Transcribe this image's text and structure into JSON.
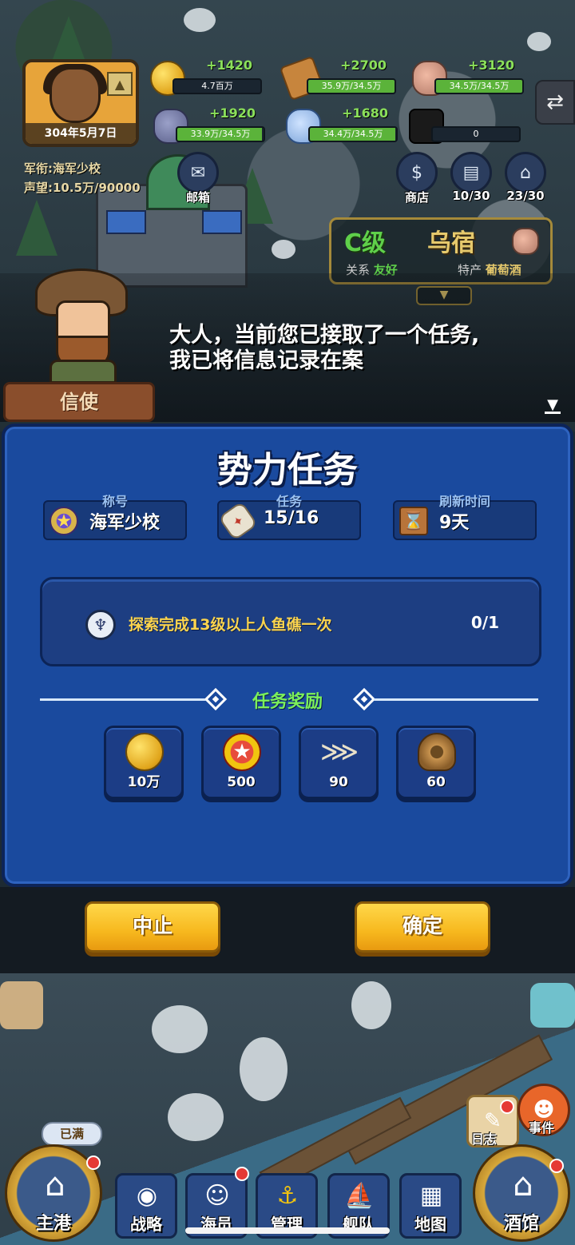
{
  "player": {
    "date": "304年5月7日",
    "rank_line": "军衔:海军少校",
    "fame_line": "声望:10.5万/90000"
  },
  "resources": [
    {
      "icon": "gold-coin-icon",
      "gain": "+1420",
      "amount": "4.7百万",
      "fill": 1.0
    },
    {
      "icon": "wood-icon",
      "gain": "+2700",
      "amount": "35.9万/34.5万",
      "fill": 1.0
    },
    {
      "icon": "stone-icon",
      "gain": "+3120",
      "amount": "34.5万/34.5万",
      "fill": 1.0
    },
    {
      "icon": "iron-ore-icon",
      "gain": "+1920",
      "amount": "33.9万/34.5万",
      "fill": 0.98
    },
    {
      "icon": "crystal-icon",
      "gain": "+1680",
      "amount": "34.4万/34.5万",
      "fill": 0.99
    },
    {
      "icon": "scholar-cap-icon",
      "gain": "",
      "amount": "0",
      "fill": 0.0
    }
  ],
  "top_buttons": {
    "mail": "邮箱",
    "shop": "商店",
    "books": "10/30",
    "crew": "23/30"
  },
  "city_card": {
    "grade": "C级",
    "name": "乌宿",
    "relation_label": "关系",
    "relation_value": "友好",
    "specialty_label": "特产",
    "specialty_value": "葡萄酒"
  },
  "dialog": {
    "speaker": "信使",
    "line1": "大人，当前您已接取了一个任务,",
    "line2": "我已将信息记录在案"
  },
  "panel": {
    "title": "势力任务",
    "stats": [
      {
        "label": "称号",
        "value": "海军少校",
        "icon": "rank-badge-icon"
      },
      {
        "label": "任务",
        "value": "15/16",
        "icon": "scroll-icon"
      },
      {
        "label": "刷新时间",
        "value": "9天",
        "icon": "hourglass-icon"
      }
    ],
    "quest": {
      "text": "探索完成13级以上人鱼礁一次",
      "progress": "0/1",
      "icon": "mermaid-icon"
    },
    "reward_title": "任务奖励",
    "rewards": [
      {
        "icon": "gold-coin-icon",
        "value": "10万"
      },
      {
        "icon": "medal-icon",
        "value": "500"
      },
      {
        "icon": "fish-bone-icon",
        "value": "90"
      },
      {
        "icon": "rope-icon",
        "value": "60"
      }
    ]
  },
  "buttons": {
    "abort": "中止",
    "confirm": "确定"
  },
  "side": {
    "log": "日志",
    "event": "事件",
    "full_tag": "已满"
  },
  "nav": {
    "home": "主港",
    "strategy": "战略",
    "crew": "海员",
    "manage": "管理",
    "fleet": "舰队",
    "map": "地图",
    "tavern": "酒馆"
  },
  "colors": {
    "panel_blue": "#1a4a9e",
    "quest_yellow": "#fbd44d",
    "reward_green": "#7cf05a",
    "button_yellow": "#f7b81e"
  }
}
